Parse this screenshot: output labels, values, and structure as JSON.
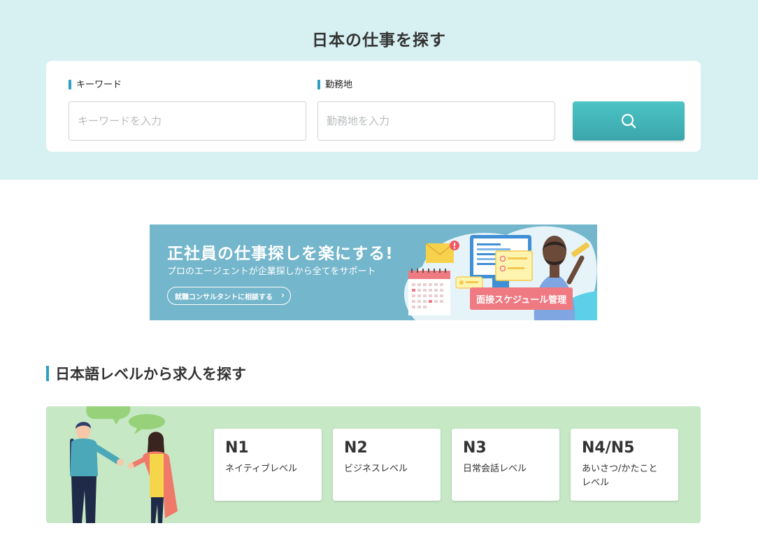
{
  "search": {
    "title": "日本の仕事を探す",
    "keyword_label": "キーワード",
    "keyword_placeholder": "キーワードを入力",
    "keyword_value": "",
    "location_label": "勤務地",
    "location_placeholder": "勤務地を入力",
    "location_value": "",
    "button_icon": "search-icon",
    "button_color": "#45b8bb"
  },
  "banner": {
    "headline": "正社員の仕事探しを楽にする!",
    "subtext": "プロのエージェントが企業探しから全てをサポート",
    "cta": "就職コンサルタントに相談する",
    "cta_icon": "chevron-right-icon",
    "feature_pill": "面接スケジュール管理",
    "background_color": "#74b6cc"
  },
  "jlpt": {
    "heading": "日本語レベルから求人を探す",
    "panel_color": "#c6e8c5",
    "levels": [
      {
        "code": "N1",
        "description": "ネイティブレベル"
      },
      {
        "code": "N2",
        "description": "ビジネスレベル"
      },
      {
        "code": "N3",
        "description": "日常会話レベル"
      },
      {
        "code": "N4/N5",
        "description": "あいさつ/かたこと\nレベル"
      }
    ]
  }
}
